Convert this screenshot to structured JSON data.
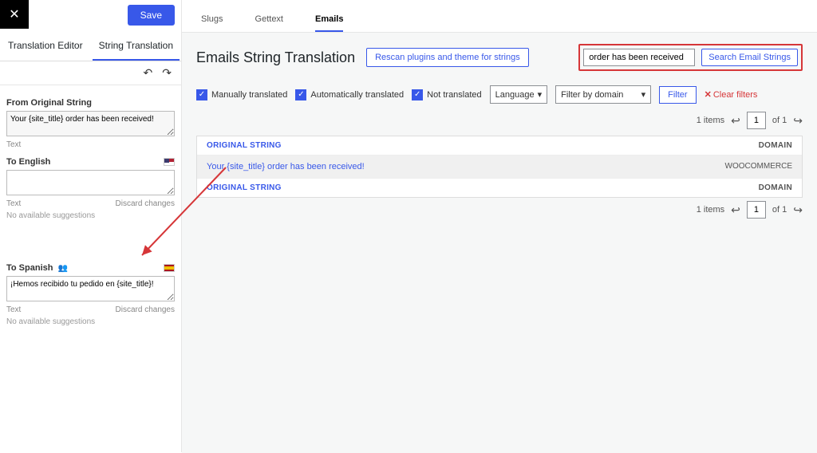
{
  "sidebar": {
    "save_label": "Save",
    "tabs": {
      "editor": "Translation Editor",
      "string": "String Translation"
    },
    "from_label": "From Original String",
    "from_value": "Your {site_title} order has been received!",
    "text_label": "Text",
    "to_en_label": "To English",
    "to_en_value": "",
    "discard_label": "Discard changes",
    "no_suggestions": "No available suggestions",
    "to_es_label": "To Spanish",
    "to_es_value": "¡Hemos recibido tu pedido en {site_title}!"
  },
  "main": {
    "top_tabs": {
      "slugs": "Slugs",
      "gettext": "Gettext",
      "emails": "Emails"
    },
    "page_title": "Emails String Translation",
    "rescan_label": "Rescan plugins and theme for strings",
    "search_value": "order has been received",
    "search_btn": "Search Email Strings",
    "filters": {
      "manual": "Manually translated",
      "auto": "Automatically translated",
      "not": "Not translated",
      "language": "Language",
      "domain": "Filter by domain",
      "filter_btn": "Filter",
      "clear": "Clear filters"
    },
    "pager": {
      "items": "1 items",
      "page": "1",
      "of": "of 1"
    },
    "table": {
      "head_original": "ORIGINAL STRING",
      "head_domain": "DOMAIN",
      "rows": [
        {
          "original": "Your {site_title} order has been received!",
          "domain": "WOOCOMMERCE"
        }
      ],
      "head2_original": "ORIGINAL STRING",
      "head2_domain": "DOMAIN"
    }
  }
}
